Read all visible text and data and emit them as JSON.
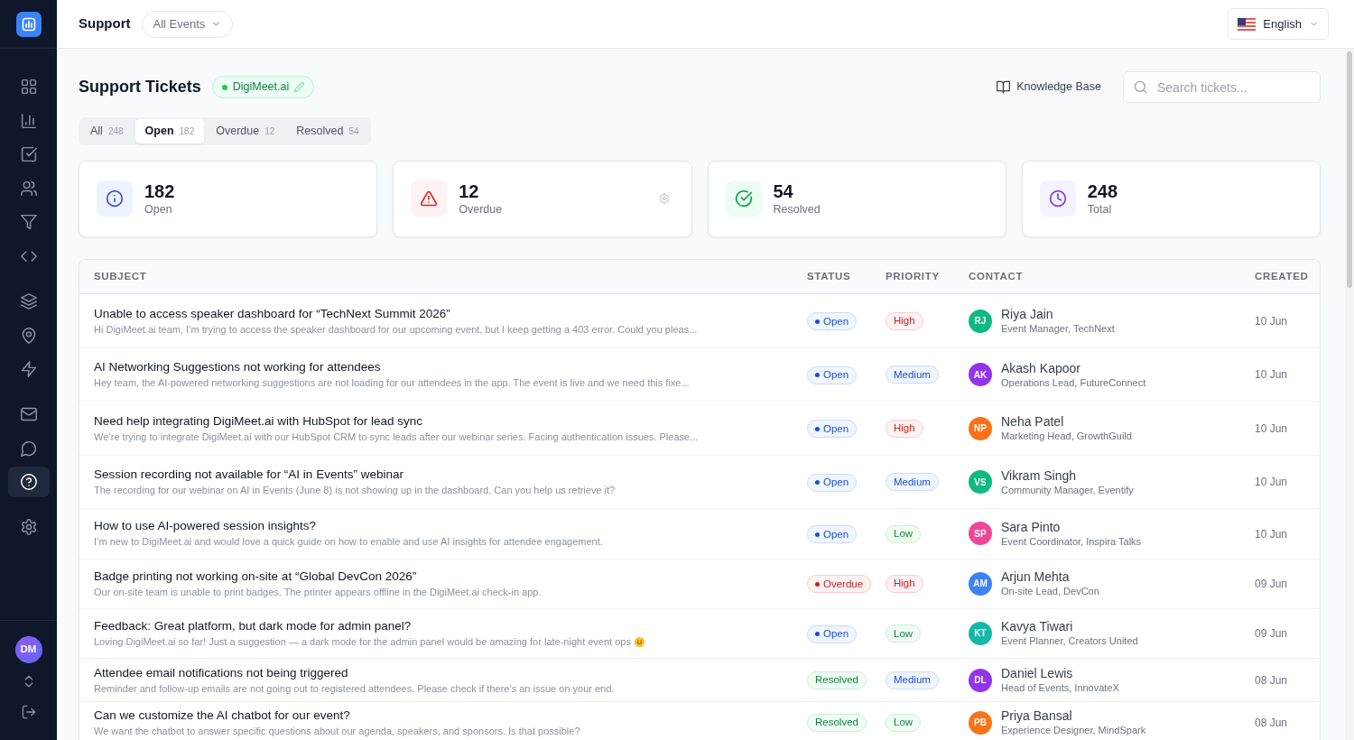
{
  "sidebar": {
    "groups": [
      [
        {
          "selected": false
        },
        {
          "selected": false
        },
        {
          "selected": false
        },
        {
          "selected": false
        },
        {
          "selected": false
        },
        {
          "selected": false
        }
      ],
      [
        {
          "selected": false
        },
        {
          "selected": false
        },
        {
          "selected": false
        }
      ],
      [
        {
          "selected": false
        },
        {
          "selected": false
        },
        {
          "selected": true
        }
      ],
      [
        {
          "selected": false
        }
      ]
    ],
    "user": {
      "initials": "DM"
    }
  },
  "header": {
    "title": "Support",
    "event_filter": "All Events",
    "language": "English"
  },
  "page": {
    "title": "Support Tickets",
    "workspace_badge": "DigiMeet.ai",
    "knowledge_base": "Knowledge Base",
    "search": {
      "placeholder": "Search tickets..."
    }
  },
  "tabs": [
    {
      "label": "All",
      "count": "248",
      "selected": false
    },
    {
      "label": "Open",
      "count": "182",
      "selected": true
    },
    {
      "label": "Overdue",
      "count": "12",
      "selected": false
    },
    {
      "label": "Resolved",
      "count": "54",
      "selected": false
    }
  ],
  "stats": [
    {
      "kind": "open",
      "value": "182",
      "label": "Open",
      "settings_button": false
    },
    {
      "kind": "overdue",
      "value": "12",
      "label": "Overdue",
      "settings_button": true
    },
    {
      "kind": "resolved",
      "value": "54",
      "label": "Resolved",
      "settings_button": false
    },
    {
      "kind": "total",
      "value": "248",
      "label": "Total",
      "settings_button": false
    }
  ],
  "table": {
    "columns": [
      "SUBJECT",
      "STATUS",
      "PRIORITY",
      "CONTACT",
      "CREATED"
    ],
    "rows": [
      {
        "subject": "Unable to access speaker dashboard for “TechNext Summit 2026”",
        "preview": "Hi DigiMeet.ai team, I’m trying to access the speaker dashboard for our upcoming event, but I keep getting a 403 error. Could you pleas...",
        "emoji": false,
        "status": {
          "kind": "open",
          "label": "Open"
        },
        "priority": {
          "kind": "high",
          "label": "High"
        },
        "contact": {
          "initials": "RJ",
          "color": "#10b981",
          "name": "Riya Jain",
          "role": "Event Manager, TechNext"
        },
        "created": "10 Jun"
      },
      {
        "subject": "AI Networking Suggestions not working for attendees",
        "preview": "Hey team, the AI-powered networking suggestions are not loading for our attendees in the app. The event is live and we need this fixe...",
        "emoji": false,
        "status": {
          "kind": "open",
          "label": "Open"
        },
        "priority": {
          "kind": "medium",
          "label": "Medium"
        },
        "contact": {
          "initials": "AK",
          "color": "#9333ea",
          "name": "Akash Kapoor",
          "role": "Operations Lead, FutureConnect"
        },
        "created": "10 Jun"
      },
      {
        "subject": "Need help integrating DigiMeet.ai with HubSpot for lead sync",
        "preview": "We’re trying to integrate DigiMeet.ai with our HubSpot CRM to sync leads after our webinar series. Facing authentication issues. Please...",
        "emoji": false,
        "status": {
          "kind": "open",
          "label": "Open"
        },
        "priority": {
          "kind": "high",
          "label": "High"
        },
        "contact": {
          "initials": "NP",
          "color": "#f97316",
          "name": "Neha Patel",
          "role": "Marketing Head, GrowthGuild"
        },
        "created": "10 Jun"
      },
      {
        "subject": "Session recording not available for “AI in Events” webinar",
        "preview": "The recording for our webinar on AI in Events (June 8) is not showing up in the dashboard. Can you help us retrieve it?",
        "emoji": false,
        "status": {
          "kind": "open",
          "label": "Open"
        },
        "priority": {
          "kind": "medium",
          "label": "Medium"
        },
        "contact": {
          "initials": "VS",
          "color": "#10b981",
          "name": "Vikram Singh",
          "role": "Community Manager, Eventify"
        },
        "created": "10 Jun"
      },
      {
        "subject": "How to use AI-powered session insights?",
        "preview": "I’m new to DigiMeet.ai and would love a quick guide on how to enable and use AI insights for attendee engagement.",
        "emoji": false,
        "status": {
          "kind": "open",
          "label": "Open"
        },
        "priority": {
          "kind": "low",
          "label": "Low"
        },
        "contact": {
          "initials": "SP",
          "color": "#ec4899",
          "name": "Sara Pinto",
          "role": "Event Coordinator, Inspira Talks"
        },
        "created": "10 Jun"
      },
      {
        "subject": "Badge printing not working on-site at “Global DevCon 2026”",
        "preview": "Our on-site team is unable to print badges. The printer appears offline in the DigiMeet.ai check-in app.",
        "emoji": false,
        "status": {
          "kind": "overdue",
          "label": "Overdue"
        },
        "priority": {
          "kind": "high",
          "label": "High"
        },
        "contact": {
          "initials": "AM",
          "color": "#3b82f6",
          "name": "Arjun Mehta",
          "role": "On-site Lead, DevCon"
        },
        "created": "09 Jun"
      },
      {
        "subject": "Feedback: Great platform, but dark mode for admin panel?",
        "preview": "Loving DigiMeet.ai so far! Just a suggestion — a dark mode for the admin panel would be amazing for late-night event ops",
        "emoji": true,
        "status": {
          "kind": "open",
          "label": "Open"
        },
        "priority": {
          "kind": "low",
          "label": "Low"
        },
        "contact": {
          "initials": "KT",
          "color": "#14b8a6",
          "name": "Kavya Tiwari",
          "role": "Event Planner, Creators United"
        },
        "created": "09 Jun"
      },
      {
        "subject": "Attendee email notifications not being triggered",
        "preview": "Reminder and follow-up emails are not going out to registered attendees. Please check if there’s an issue on your end.",
        "emoji": false,
        "status": {
          "kind": "resolved",
          "label": "Resolved"
        },
        "priority": {
          "kind": "medium",
          "label": "Medium"
        },
        "contact": {
          "initials": "DL",
          "color": "#9333ea",
          "name": "Daniel Lewis",
          "role": "Head of Events, InnovateX"
        },
        "created": "08 Jun"
      },
      {
        "subject": "Can we customize the AI chatbot for our event?",
        "preview": "We want the chatbot to answer specific questions about our agenda, speakers, and sponsors. Is that possible?",
        "emoji": false,
        "status": {
          "kind": "resolved",
          "label": "Resolved"
        },
        "priority": {
          "kind": "low",
          "label": "Low"
        },
        "contact": {
          "initials": "PB",
          "color": "#f97316",
          "name": "Priya Bansal",
          "role": "Experience Designer, MindSpark"
        },
        "created": "08 Jun"
      }
    ]
  }
}
